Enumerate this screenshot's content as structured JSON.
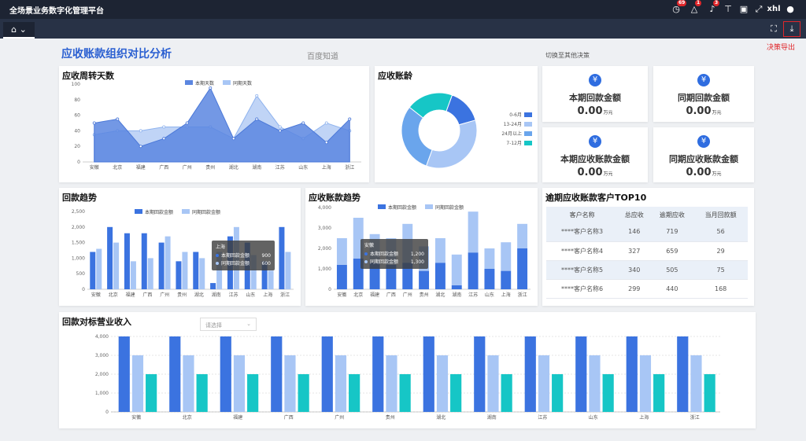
{
  "app": {
    "title": "全场景业务数字化管理平台",
    "user": "xhl",
    "badges": {
      "clock": "69",
      "warn": "1",
      "bell": "3"
    }
  },
  "tab": {
    "home_icon": "home-icon",
    "chevron": "⌄"
  },
  "export_label": "决策导出",
  "page": {
    "title": "应收账款组织对比分析",
    "baidu": "百度知道",
    "switch": "切换至其他决策"
  },
  "turnover": {
    "title": "应收周转天数",
    "legend": [
      "本期天数",
      "同期天数"
    ],
    "chart_data": {
      "type": "area",
      "categories": [
        "安徽",
        "北京",
        "福建",
        "广西",
        "广州",
        "贵州",
        "湖北",
        "湖南",
        "江苏",
        "山东",
        "上海",
        "浙江"
      ],
      "ylim": [
        0,
        100
      ],
      "yticks": [
        "0",
        "20",
        "40",
        "60",
        "80",
        "100"
      ],
      "series": [
        {
          "name": "本期天数",
          "values": [
            50,
            55,
            20,
            30,
            50,
            95,
            30,
            55,
            40,
            50,
            25,
            55
          ]
        },
        {
          "name": "同期天数",
          "values": [
            35,
            40,
            40,
            45,
            45,
            45,
            30,
            85,
            45,
            30,
            50,
            40
          ]
        }
      ]
    }
  },
  "aging": {
    "title": "应收账龄",
    "chart_data": {
      "type": "pie",
      "labels": [
        "0-6月",
        "13-24月",
        "24月以上",
        "7-12月"
      ],
      "values": [
        15,
        35,
        30,
        20
      ],
      "colors": [
        "#3b73e0",
        "#a8c6f5",
        "#6aa5ec",
        "#16c6c6"
      ]
    }
  },
  "cards": [
    {
      "label": "本期回款金额",
      "value": "0.00",
      "unit": "万元"
    },
    {
      "label": "同期回款金额",
      "value": "0.00",
      "unit": "万元"
    },
    {
      "label": "本期应收账款金额",
      "value": "0.00",
      "unit": "万元"
    },
    {
      "label": "同期应收账款金额",
      "value": "0.00",
      "unit": "万元"
    }
  ],
  "payback": {
    "title": "回款趋势",
    "legend": [
      "本期回款金额",
      "同期回款金额"
    ],
    "tooltip": {
      "title": "上海",
      "rows": [
        [
          "本期回款金额",
          "900"
        ],
        [
          "同期回款金额",
          "600"
        ]
      ]
    },
    "chart_data": {
      "type": "bar",
      "categories": [
        "安徽",
        "北京",
        "福建",
        "广西",
        "广州",
        "贵州",
        "湖北",
        "湖南",
        "江苏",
        "山东",
        "上海",
        "浙江"
      ],
      "ylim": [
        0,
        2500
      ],
      "yticks": [
        "0",
        "500",
        "1,000",
        "1,500",
        "2,000",
        "2,500"
      ],
      "series": [
        {
          "name": "本期回款金额",
          "values": [
            1200,
            2000,
            1800,
            1800,
            1500,
            900,
            1200,
            200,
            1700,
            1500,
            900,
            2000
          ]
        },
        {
          "name": "同期回款金额",
          "values": [
            1300,
            1500,
            900,
            1000,
            1700,
            1200,
            1000,
            1200,
            2000,
            1100,
            600,
            1200
          ]
        }
      ]
    }
  },
  "artrend": {
    "title": "应收账款趋势",
    "legend": [
      "本期回款金额",
      "同期回款金额"
    ],
    "tooltip": {
      "title": "安徽",
      "rows": [
        [
          "本期回款金额",
          "1,200"
        ],
        [
          "同期回款金额",
          "1,300"
        ]
      ]
    },
    "chart_data": {
      "type": "bar",
      "stacked": true,
      "categories": [
        "安徽",
        "北京",
        "福建",
        "广西",
        "广州",
        "贵州",
        "湖北",
        "湖南",
        "江苏",
        "山东",
        "上海",
        "浙江"
      ],
      "ylim": [
        0,
        4000
      ],
      "yticks": [
        "0",
        "1,000",
        "2,000",
        "3,000",
        "4,000"
      ],
      "series": [
        {
          "name": "本期回款金额",
          "values": [
            1200,
            1500,
            1300,
            1200,
            1300,
            900,
            1300,
            200,
            1800,
            1000,
            900,
            2000
          ]
        },
        {
          "name": "同期回款金额",
          "values": [
            1300,
            2000,
            1400,
            1300,
            1900,
            1200,
            1200,
            1500,
            2000,
            1000,
            1400,
            1200
          ]
        }
      ]
    }
  },
  "top10": {
    "title": "逾期应收账款客户TOP10",
    "headers": [
      "客户名称",
      "总应收",
      "逾期应收",
      "当月回款额"
    ],
    "rows": [
      [
        "****客户名称3",
        "146",
        "719",
        "56"
      ],
      [
        "****客户名称4",
        "327",
        "659",
        "29"
      ],
      [
        "****客户名称5",
        "340",
        "505",
        "75"
      ],
      [
        "****客户名称6",
        "299",
        "440",
        "168"
      ]
    ]
  },
  "revenue": {
    "title": "回款对标营业收入",
    "select_placeholder": "请选择",
    "chart_data": {
      "type": "bar",
      "categories": [
        "安徽",
        "北京",
        "福建",
        "广西",
        "广州",
        "贵州",
        "湖北",
        "湖南",
        "江苏",
        "山东",
        "上海",
        "浙江"
      ],
      "ylim": [
        0,
        4000
      ],
      "yticks": [
        "0",
        "1,000",
        "2,000",
        "3,000",
        "4,000"
      ],
      "series": [
        {
          "values": [
            4000,
            4000,
            4000,
            4000,
            4000,
            4000,
            4000,
            4000,
            4000,
            4000,
            4000,
            4000
          ]
        },
        {
          "values": [
            3000,
            3000,
            3000,
            3000,
            3000,
            3000,
            3000,
            3000,
            3000,
            3000,
            3000,
            3000
          ]
        },
        {
          "values": [
            2000,
            2000,
            2000,
            2000,
            2000,
            2000,
            2000,
            2000,
            2000,
            2000,
            2000,
            2000
          ]
        }
      ]
    }
  }
}
